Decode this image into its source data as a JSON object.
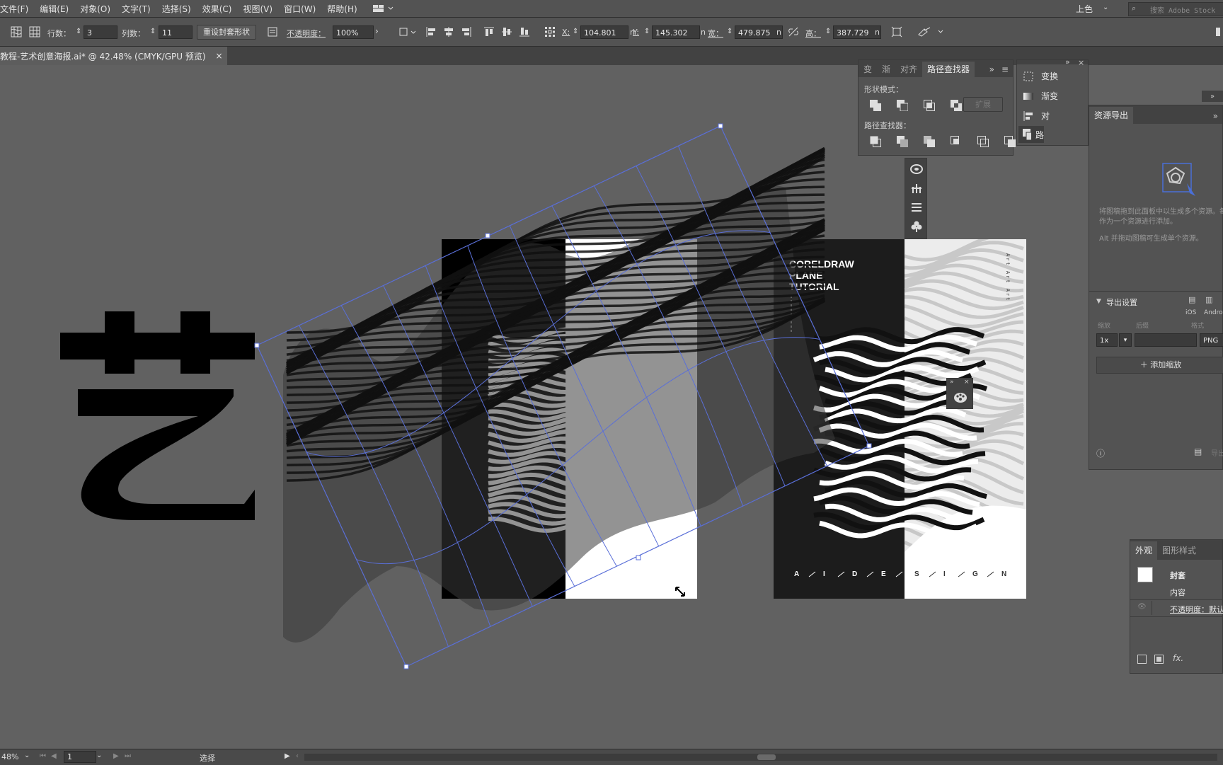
{
  "menu": [
    "文件(F)",
    "编辑(E)",
    "对象(O)",
    "文字(T)",
    "选择(S)",
    "效果(C)",
    "视图(V)",
    "窗口(W)",
    "帮助(H)"
  ],
  "workspace": {
    "name": "上色",
    "search_placeholder": "搜索 Adobe Stock"
  },
  "control": {
    "rows_label": "行数：",
    "rows_value": "3",
    "cols_label": "列数：",
    "cols_value": "11",
    "reset_button": "重设封套形状",
    "opacity_label": "不透明度：",
    "opacity_value": "100%",
    "x_label": "X:",
    "x_value": "104.801",
    "y_label": "Y:",
    "y_value": "145.302",
    "w_label": "宽：",
    "w_value": "479.875",
    "h_label": "高：",
    "h_value": "387.729",
    "unit": "n"
  },
  "document": {
    "tab_title": "教程-艺术创意海报.ai* @ 42.48% (CMYK/GPU 预览)",
    "close": "×"
  },
  "pathfinder_panel": {
    "tabs": [
      "变",
      "渐",
      "对齐",
      "路径查找器"
    ],
    "active_tab": "路径查找器",
    "shape_modes_label": "形状模式：",
    "expand_label": "扩展",
    "pathfinders_label": "路径查找器："
  },
  "side_panel": {
    "items": [
      "变换",
      "渐变",
      "对",
      "路"
    ]
  },
  "asset_export": {
    "title": "资源导出",
    "hint1": "将图稿拖到此面板中以生成多个资源。每个组合或对象将",
    "hint1b": "作为一个资源进行添加。",
    "hint2": "Alt 并拖动图稿可生成单个资源。",
    "export_settings": "导出设置",
    "ios": "iOS",
    "android": "Android",
    "col_scale": "缩放",
    "col_suffix": "后缀",
    "col_format": "格式",
    "scale_value": "1x",
    "format_value": "PNG",
    "add_scale": "添加缩放",
    "export_btn": "导出"
  },
  "appearance": {
    "tabs": [
      "外观",
      "图形样式"
    ],
    "envelope": "封套",
    "contents": "内容",
    "opacity": "不透明度：默认值",
    "fx": "fx."
  },
  "artwork": {
    "big_char": "艺",
    "poster_title": [
      "CORELDRAW",
      "PLANE",
      "TUTORIAL"
    ],
    "poster_letters": [
      "A",
      "I",
      "D",
      "E",
      "S",
      "I",
      "G",
      "N"
    ],
    "vertical_text": "Art Art Art"
  },
  "status": {
    "zoom": "48%",
    "page": "1",
    "tool": "选择"
  }
}
